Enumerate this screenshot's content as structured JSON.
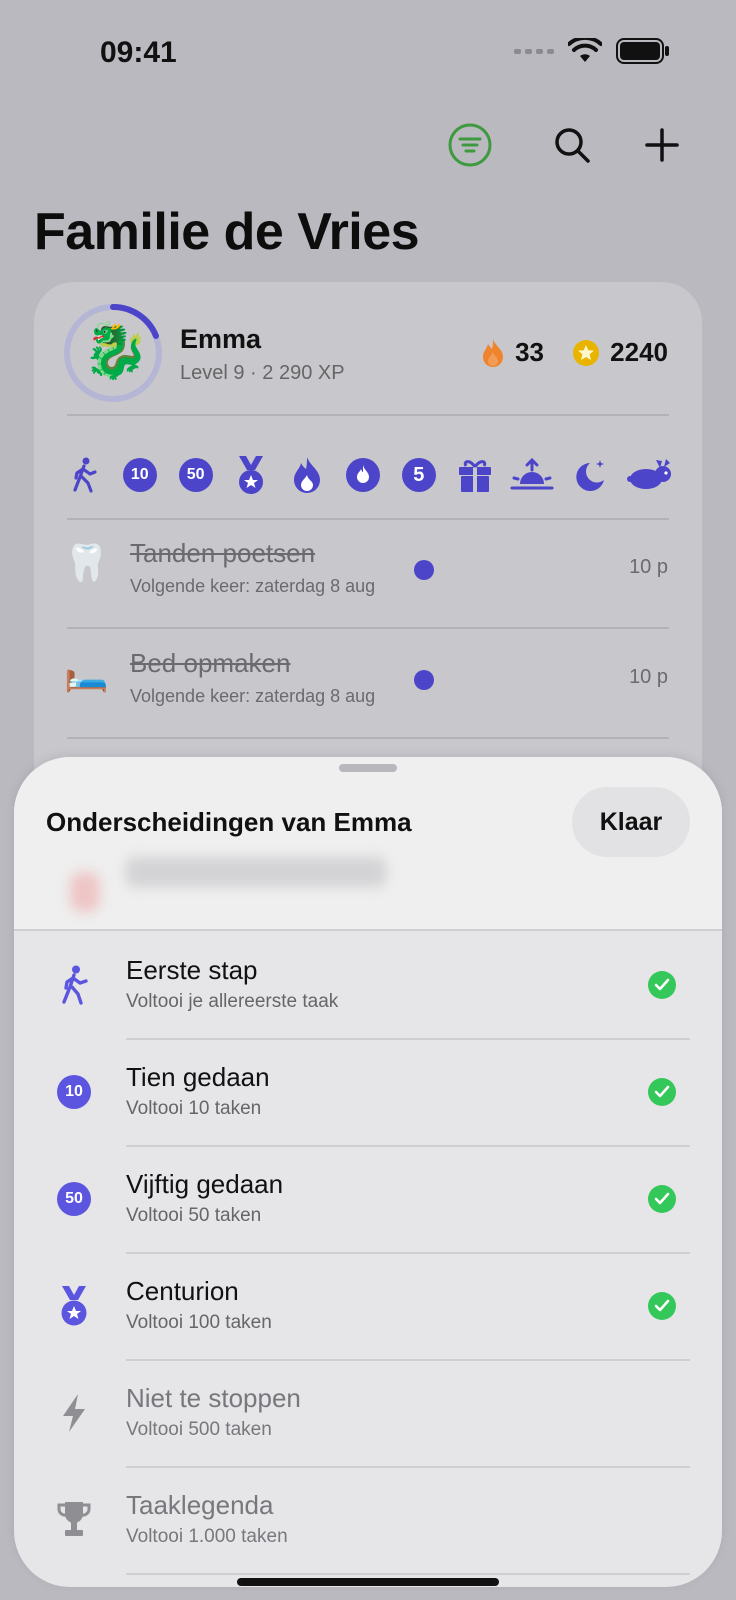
{
  "status_bar": {
    "time": "09:41"
  },
  "toolbar": {
    "filter_icon": "filter-icon",
    "search_icon": "search-icon",
    "add_icon": "plus-icon",
    "accent_green": "#3f9a3f"
  },
  "page": {
    "title": "Familie de Vries"
  },
  "profile": {
    "avatar_emoji": "🐉",
    "name": "Emma",
    "level": "Level 9 · 2 290 XP",
    "level_progress": 0.3,
    "streak": "33",
    "coins": "2240"
  },
  "badges": [
    {
      "icon": "walking-icon"
    },
    {
      "label": "10"
    },
    {
      "label": "50"
    },
    {
      "icon": "medal-icon"
    },
    {
      "icon": "flame-icon"
    },
    {
      "icon": "flame-circle-icon"
    },
    {
      "label": "5"
    },
    {
      "icon": "gift-icon"
    },
    {
      "icon": "sunrise-icon"
    },
    {
      "icon": "moon-stars-icon"
    },
    {
      "icon": "rabbit-icon"
    }
  ],
  "tasks": [
    {
      "emoji": "🦷",
      "title": "Tanden poetsen",
      "subtitle": "Volgende keer: zaterdag 8 aug",
      "points": "10 p"
    },
    {
      "emoji": "🛏️",
      "title": "Bed opmaken",
      "subtitle": "Volgende keer: zaterdag 8 aug",
      "points": "10 p"
    }
  ],
  "sheet": {
    "title": "Onderscheidingen van Emma",
    "done_label": "Klaar",
    "achievements": [
      {
        "icon": "walking-icon",
        "title": "Eerste stap",
        "description": "Voltooi je allereerste taak",
        "achieved": true
      },
      {
        "badge": "10",
        "title": "Tien gedaan",
        "description": "Voltooi 10 taken",
        "achieved": true
      },
      {
        "badge": "50",
        "title": "Vijftig gedaan",
        "description": "Voltooi 50 taken",
        "achieved": true
      },
      {
        "icon": "medal-icon",
        "title": "Centurion",
        "description": "Voltooi 100 taken",
        "achieved": true
      },
      {
        "icon": "bolt-icon",
        "title": "Niet te stoppen",
        "description": "Voltooi 500 taken",
        "achieved": false
      },
      {
        "icon": "trophy-icon",
        "title": "Taaklegenda",
        "description": "Voltooi 1.000 taken",
        "achieved": false
      }
    ]
  },
  "colors": {
    "badge_blue": "#4c45c9",
    "check_green": "#34c759",
    "flame_orange": "#f0842c",
    "coin_yellow": "#e8b400"
  }
}
